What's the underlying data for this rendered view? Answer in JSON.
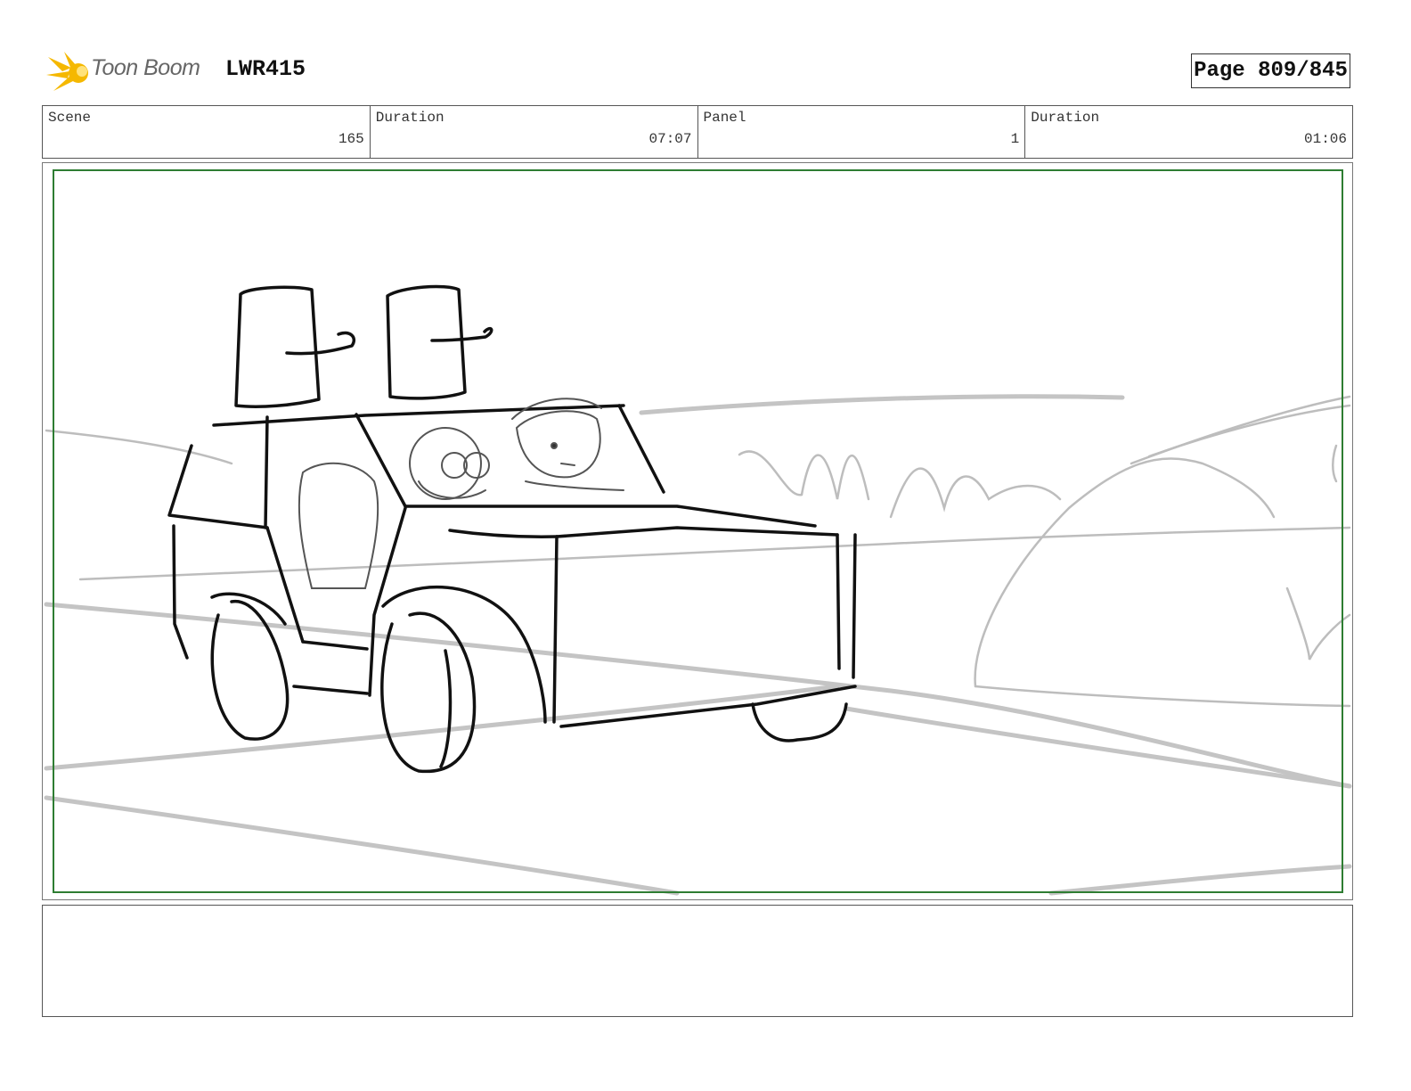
{
  "header": {
    "logo_text": "Toon Boom",
    "project": "LWR415",
    "page_label": "Page 809/845"
  },
  "info": [
    {
      "label": "Scene",
      "value": "165"
    },
    {
      "label": "Duration",
      "value": "07:07"
    },
    {
      "label": "Panel",
      "value": "1"
    },
    {
      "label": "Duration",
      "value": "01:06"
    }
  ],
  "colors": {
    "safe_frame": "#2e7d32",
    "logo_accent": "#f5b800"
  },
  "icons": [
    "toon-boom-logo-icon"
  ],
  "notes": {
    "text": ""
  }
}
